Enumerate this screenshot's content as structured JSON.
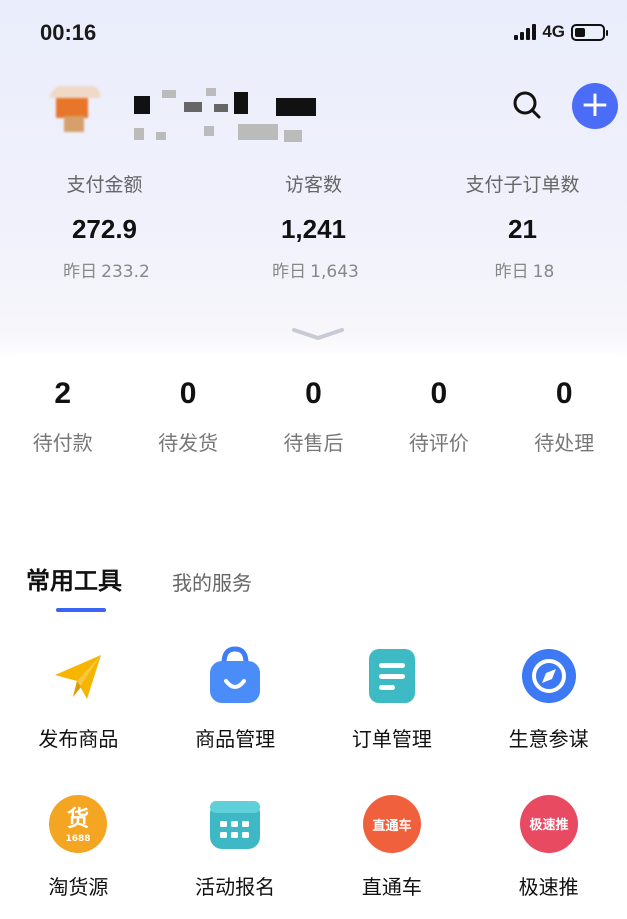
{
  "status_bar": {
    "time": "00:16",
    "network": "4G"
  },
  "header": {
    "add_symbol": "+"
  },
  "stats": [
    {
      "label": "支付金额",
      "value": "272.9",
      "yesterday_label": "昨日",
      "yesterday_value": "233.2"
    },
    {
      "label": "访客数",
      "value": "1,241",
      "yesterday_label": "昨日",
      "yesterday_value": "1,643"
    },
    {
      "label": "支付子订单数",
      "value": "21",
      "yesterday_label": "昨日",
      "yesterday_value": "18"
    }
  ],
  "orders": [
    {
      "count": "2",
      "label": "待付款"
    },
    {
      "count": "0",
      "label": "待发货"
    },
    {
      "count": "0",
      "label": "待售后"
    },
    {
      "count": "0",
      "label": "待评价"
    },
    {
      "count": "0",
      "label": "待处理"
    }
  ],
  "tabs": {
    "tools": "常用工具",
    "services": "我的服务"
  },
  "tools": [
    {
      "label": "发布商品",
      "icon": "paper-plane-icon"
    },
    {
      "label": "商品管理",
      "icon": "shopping-bag-icon"
    },
    {
      "label": "订单管理",
      "icon": "document-list-icon"
    },
    {
      "label": "生意参谋",
      "icon": "compass-icon"
    },
    {
      "label": "淘货源",
      "icon": "goods-source-icon",
      "badge_text": "货",
      "badge_sub": "1688"
    },
    {
      "label": "活动报名",
      "icon": "calendar-icon"
    },
    {
      "label": "直通车",
      "icon": "ztc-icon",
      "badge_text": "直通车"
    },
    {
      "label": "极速推",
      "icon": "jisutui-icon",
      "badge_text": "极速推"
    }
  ],
  "colors": {
    "accent": "#3b63f5",
    "add_button": "#4a6cf7"
  }
}
